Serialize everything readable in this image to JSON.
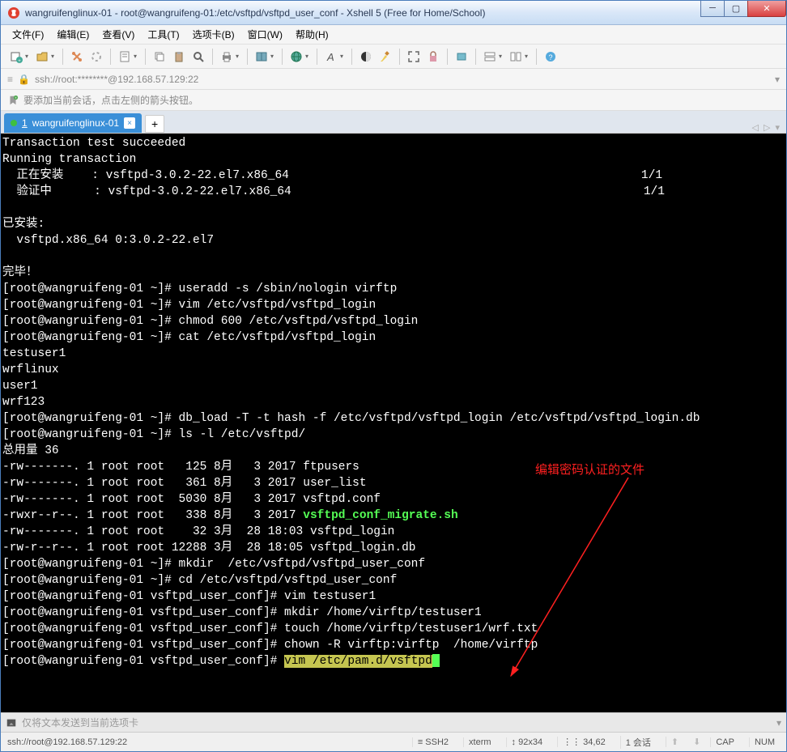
{
  "window": {
    "title": "wangruifenglinux-01 - root@wangruifeng-01:/etc/vsftpd/vsftpd_user_conf - Xshell 5 (Free for Home/School)"
  },
  "menubar": {
    "file": "文件(F)",
    "edit": "编辑(E)",
    "view": "查看(V)",
    "tools": "工具(T)",
    "tabs": "选项卡(B)",
    "window": "窗口(W)",
    "help": "帮助(H)"
  },
  "addressbar": {
    "text": "ssh://root:********@192.168.57.129:22"
  },
  "infobar": {
    "text": "要添加当前会话，点击左侧的箭头按钮。"
  },
  "tab": {
    "index": "1",
    "label": "wangruifenglinux-01"
  },
  "terminal": {
    "lines": [
      "Transaction test succeeded",
      "Running transaction",
      "  正在安装    : vsftpd-3.0.2-22.el7.x86_64                                                  1/1",
      "  验证中      : vsftpd-3.0.2-22.el7.x86_64                                                  1/1",
      "",
      "已安装:",
      "  vsftpd.x86_64 0:3.0.2-22.el7",
      "",
      "完毕！",
      "[root@wangruifeng-01 ~]# useradd -s /sbin/nologin virftp",
      "[root@wangruifeng-01 ~]# vim /etc/vsftpd/vsftpd_login",
      "[root@wangruifeng-01 ~]# chmod 600 /etc/vsftpd/vsftpd_login",
      "[root@wangruifeng-01 ~]# cat /etc/vsftpd/vsftpd_login",
      "testuser1",
      "wrflinux",
      "user1",
      "wrf123",
      "[root@wangruifeng-01 ~]# db_load -T -t hash -f /etc/vsftpd/vsftpd_login /etc/vsftpd/vsftpd_login.db",
      "[root@wangruifeng-01 ~]# ls -l /etc/vsftpd/",
      "总用量 36",
      "-rw-------. 1 root root   125 8月   3 2017 ftpusers",
      "-rw-------. 1 root root   361 8月   3 2017 user_list",
      "-rw-------. 1 root root  5030 8月   3 2017 vsftpd.conf",
      "-rwxr--r--. 1 root root   338 8月   3 2017 ",
      "-rw-------. 1 root root    32 3月  28 18:03 vsftpd_login",
      "-rw-r--r--. 1 root root 12288 3月  28 18:05 vsftpd_login.db",
      "[root@wangruifeng-01 ~]# mkdir  /etc/vsftpd/vsftpd_user_conf",
      "[root@wangruifeng-01 ~]# cd /etc/vsftpd/vsftpd_user_conf",
      "[root@wangruifeng-01 vsftpd_user_conf]# vim testuser1",
      "[root@wangruifeng-01 vsftpd_user_conf]# mkdir /home/virftp/testuser1",
      "[root@wangruifeng-01 vsftpd_user_conf]# touch /home/virftp/testuser1/wrf.txt",
      "[root@wangruifeng-01 vsftpd_user_conf]# chown -R virftp:virftp  /home/virftp",
      "[root@wangruifeng-01 vsftpd_user_conf]# "
    ],
    "green_file": "vsftpd_conf_migrate.sh",
    "highlighted_cmd": "vim /etc/pam.d/vsftpd",
    "annotation": "编辑密码认证的文件"
  },
  "sendbar": {
    "placeholder": "仅将文本发送到当前选项卡"
  },
  "statusbar": {
    "conn": "ssh://root@192.168.57.129:22",
    "ssh": "SSH2",
    "term": "xterm",
    "size": "92x34",
    "pos": "34,62",
    "sessions": "1 会话",
    "cap": "CAP",
    "num": "NUM"
  },
  "icons": {
    "lock": "🔒",
    "ssh_badge": "≡",
    "size_arrows": "↕",
    "rows_icon": "⋮⋮",
    "up": "⬆",
    "down": "⬇"
  }
}
